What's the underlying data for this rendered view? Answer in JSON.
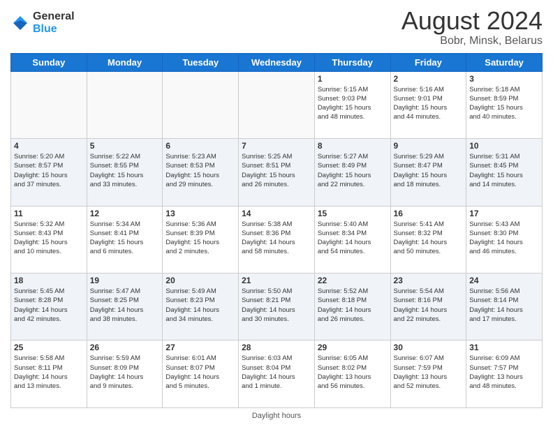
{
  "logo": {
    "line1": "General",
    "line2": "Blue"
  },
  "title": "August 2024",
  "subtitle": "Bobr, Minsk, Belarus",
  "days_of_week": [
    "Sunday",
    "Monday",
    "Tuesday",
    "Wednesday",
    "Thursday",
    "Friday",
    "Saturday"
  ],
  "weeks": [
    [
      {
        "day": "",
        "info": ""
      },
      {
        "day": "",
        "info": ""
      },
      {
        "day": "",
        "info": ""
      },
      {
        "day": "",
        "info": ""
      },
      {
        "day": "1",
        "info": "Sunrise: 5:15 AM\nSunset: 9:03 PM\nDaylight: 15 hours\nand 48 minutes."
      },
      {
        "day": "2",
        "info": "Sunrise: 5:16 AM\nSunset: 9:01 PM\nDaylight: 15 hours\nand 44 minutes."
      },
      {
        "day": "3",
        "info": "Sunrise: 5:18 AM\nSunset: 8:59 PM\nDaylight: 15 hours\nand 40 minutes."
      }
    ],
    [
      {
        "day": "4",
        "info": "Sunrise: 5:20 AM\nSunset: 8:57 PM\nDaylight: 15 hours\nand 37 minutes."
      },
      {
        "day": "5",
        "info": "Sunrise: 5:22 AM\nSunset: 8:55 PM\nDaylight: 15 hours\nand 33 minutes."
      },
      {
        "day": "6",
        "info": "Sunrise: 5:23 AM\nSunset: 8:53 PM\nDaylight: 15 hours\nand 29 minutes."
      },
      {
        "day": "7",
        "info": "Sunrise: 5:25 AM\nSunset: 8:51 PM\nDaylight: 15 hours\nand 26 minutes."
      },
      {
        "day": "8",
        "info": "Sunrise: 5:27 AM\nSunset: 8:49 PM\nDaylight: 15 hours\nand 22 minutes."
      },
      {
        "day": "9",
        "info": "Sunrise: 5:29 AM\nSunset: 8:47 PM\nDaylight: 15 hours\nand 18 minutes."
      },
      {
        "day": "10",
        "info": "Sunrise: 5:31 AM\nSunset: 8:45 PM\nDaylight: 15 hours\nand 14 minutes."
      }
    ],
    [
      {
        "day": "11",
        "info": "Sunrise: 5:32 AM\nSunset: 8:43 PM\nDaylight: 15 hours\nand 10 minutes."
      },
      {
        "day": "12",
        "info": "Sunrise: 5:34 AM\nSunset: 8:41 PM\nDaylight: 15 hours\nand 6 minutes."
      },
      {
        "day": "13",
        "info": "Sunrise: 5:36 AM\nSunset: 8:39 PM\nDaylight: 15 hours\nand 2 minutes."
      },
      {
        "day": "14",
        "info": "Sunrise: 5:38 AM\nSunset: 8:36 PM\nDaylight: 14 hours\nand 58 minutes."
      },
      {
        "day": "15",
        "info": "Sunrise: 5:40 AM\nSunset: 8:34 PM\nDaylight: 14 hours\nand 54 minutes."
      },
      {
        "day": "16",
        "info": "Sunrise: 5:41 AM\nSunset: 8:32 PM\nDaylight: 14 hours\nand 50 minutes."
      },
      {
        "day": "17",
        "info": "Sunrise: 5:43 AM\nSunset: 8:30 PM\nDaylight: 14 hours\nand 46 minutes."
      }
    ],
    [
      {
        "day": "18",
        "info": "Sunrise: 5:45 AM\nSunset: 8:28 PM\nDaylight: 14 hours\nand 42 minutes."
      },
      {
        "day": "19",
        "info": "Sunrise: 5:47 AM\nSunset: 8:25 PM\nDaylight: 14 hours\nand 38 minutes."
      },
      {
        "day": "20",
        "info": "Sunrise: 5:49 AM\nSunset: 8:23 PM\nDaylight: 14 hours\nand 34 minutes."
      },
      {
        "day": "21",
        "info": "Sunrise: 5:50 AM\nSunset: 8:21 PM\nDaylight: 14 hours\nand 30 minutes."
      },
      {
        "day": "22",
        "info": "Sunrise: 5:52 AM\nSunset: 8:18 PM\nDaylight: 14 hours\nand 26 minutes."
      },
      {
        "day": "23",
        "info": "Sunrise: 5:54 AM\nSunset: 8:16 PM\nDaylight: 14 hours\nand 22 minutes."
      },
      {
        "day": "24",
        "info": "Sunrise: 5:56 AM\nSunset: 8:14 PM\nDaylight: 14 hours\nand 17 minutes."
      }
    ],
    [
      {
        "day": "25",
        "info": "Sunrise: 5:58 AM\nSunset: 8:11 PM\nDaylight: 14 hours\nand 13 minutes."
      },
      {
        "day": "26",
        "info": "Sunrise: 5:59 AM\nSunset: 8:09 PM\nDaylight: 14 hours\nand 9 minutes."
      },
      {
        "day": "27",
        "info": "Sunrise: 6:01 AM\nSunset: 8:07 PM\nDaylight: 14 hours\nand 5 minutes."
      },
      {
        "day": "28",
        "info": "Sunrise: 6:03 AM\nSunset: 8:04 PM\nDaylight: 14 hours\nand 1 minute."
      },
      {
        "day": "29",
        "info": "Sunrise: 6:05 AM\nSunset: 8:02 PM\nDaylight: 13 hours\nand 56 minutes."
      },
      {
        "day": "30",
        "info": "Sunrise: 6:07 AM\nSunset: 7:59 PM\nDaylight: 13 hours\nand 52 minutes."
      },
      {
        "day": "31",
        "info": "Sunrise: 6:09 AM\nSunset: 7:57 PM\nDaylight: 13 hours\nand 48 minutes."
      }
    ]
  ],
  "footer": "Daylight hours"
}
